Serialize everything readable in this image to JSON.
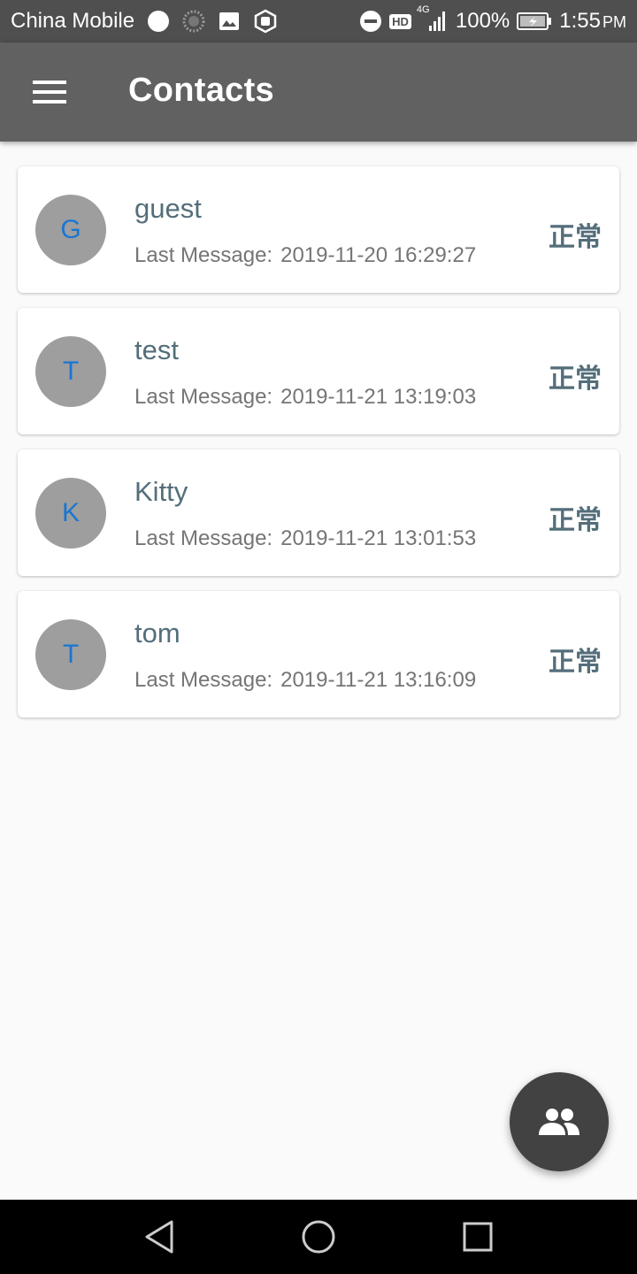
{
  "status_bar": {
    "carrier": "China Mobile",
    "network_type": "4G",
    "hd_badge": "HD",
    "battery": "100%",
    "time": "1:55",
    "time_suffix": "PM"
  },
  "app_bar": {
    "title": "Contacts",
    "menu_icon": "hamburger-menu-icon"
  },
  "contacts": [
    {
      "initial": "G",
      "name": "guest",
      "last_message_label": "Last Message:",
      "last_message_time": "2019-11-20 16:29:27",
      "status": "正常"
    },
    {
      "initial": "T",
      "name": "test",
      "last_message_label": "Last Message:",
      "last_message_time": "2019-11-21 13:19:03",
      "status": "正常"
    },
    {
      "initial": "K",
      "name": "Kitty",
      "last_message_label": "Last Message:",
      "last_message_time": "2019-11-21 13:01:53",
      "status": "正常"
    },
    {
      "initial": "T",
      "name": "tom",
      "last_message_label": "Last Message:",
      "last_message_time": "2019-11-21 13:16:09",
      "status": "正常"
    }
  ],
  "fab": {
    "icon": "group-icon"
  },
  "nav_bar": {
    "back_icon": "back-triangle-icon",
    "home_icon": "home-circle-icon",
    "recents_icon": "recents-square-icon"
  },
  "colors": {
    "status_bar_bg": "#4f4f4f",
    "app_bar_bg": "#616161",
    "avatar_bg": "#9e9e9e",
    "avatar_text": "#1976d2",
    "name_text": "#546e7a",
    "fab_bg": "#424242"
  }
}
